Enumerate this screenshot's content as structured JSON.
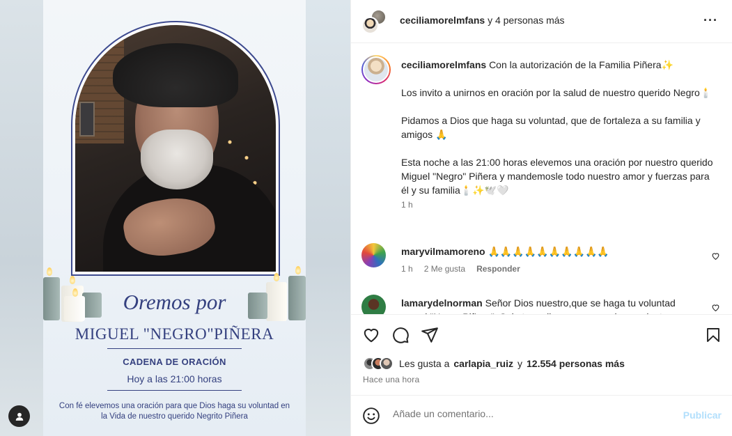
{
  "media": {
    "title_script": "Oremos por",
    "name": "MIGUEL \"NEGRO\"PIÑERA",
    "subtitle": "CADENA DE ORACIÓN",
    "time": "Hoy a las 21:00 horas",
    "footer": "Con fé elevemos una oración para que Dios haga su voluntad en la Vida de nuestro querido Negrito Piñera"
  },
  "header": {
    "username": "ceciliamorelmfans",
    "others": "y 4 personas más",
    "more_icon": "more-horizontal-icon"
  },
  "post": {
    "username": "ceciliamorelmfans",
    "caption": "Con la autorización de la Familia Piñera✨\n\nLos invito a unirnos en oración por la salud de nuestro querido Negro🕯️\n\nPidamos a Dios que haga su voluntad, que de fortaleza a su familia y amigos 🙏\n\nEsta noche a las 21:00 horas elevemos una oración por nuestro querido Miguel \"Negro\" Piñera y mandemosle todo nuestro amor y fuerzas para él y su familia🕯️✨🕊️🤍",
    "time": "1 h"
  },
  "comments": [
    {
      "username": "maryvilmamoreno",
      "text": "🙏🙏🙏🙏🙏🙏🙏🙏🙏🙏",
      "time": "1 h",
      "likes": "2 Me gusta",
      "reply": "Responder"
    },
    {
      "username": "lamarydelnorman",
      "text": "Señor Dios nuestro,que se haga tu voluntad con el \"Negro Piñera\". Solo te pedimos que seas benevolente en"
    }
  ],
  "likes": {
    "prefix": "Les gusta a",
    "user": "carlapia_ruiz",
    "middle": "y",
    "count": "12.554 personas más"
  },
  "posted": "Hace una hora",
  "comment_box": {
    "placeholder": "Añade un comentario...",
    "publish": "Publicar"
  },
  "colors": {
    "accent_text": "#34407f",
    "publish_disabled": "#b2dffc"
  }
}
